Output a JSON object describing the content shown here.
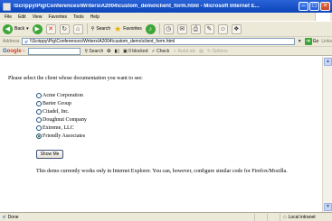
{
  "window": {
    "title": "\\Scrippy\\Pig\\Conferences\\Writers\\A2004\\custom_demo\\client_form.html - Microsoft Internet E..."
  },
  "menu": {
    "items": [
      "File",
      "Edit",
      "View",
      "Favorites",
      "Tools",
      "Help"
    ]
  },
  "toolbar": {
    "back_label": "Back",
    "search_label": "Search",
    "favorites_label": "Favorites"
  },
  "address": {
    "label": "Address",
    "value": "\\\\Scrippy\\Pig\\Conferences\\Writers\\A2004\\custom_demo\\client_form.html",
    "go_label": "Go",
    "links_label": "Links"
  },
  "googlebar": {
    "brand_g": "G",
    "brand_rest": "oogle -",
    "search_label": "Search",
    "blocked_label": "0 blocked",
    "check_label": "Check",
    "autolink_label": "AutoLink",
    "options_label": "Options"
  },
  "page": {
    "prompt": "Please select the client whose documentation you want to see:",
    "clients": [
      {
        "label": "Acme Corporation",
        "checked": false
      },
      {
        "label": "Barter Group",
        "checked": false
      },
      {
        "label": "Citadel, Inc.",
        "checked": false
      },
      {
        "label": "Doughnut Company",
        "checked": false
      },
      {
        "label": "Extreme, LLC",
        "checked": false
      },
      {
        "label": "Friendly Associates",
        "checked": true
      }
    ],
    "button_label": "Show Me",
    "note": "This demo currently works only in Internet Explorer. You can, however, configure similar code for Firefox/Mozilla."
  },
  "status": {
    "left": "Done",
    "zone": "Local intranet"
  },
  "colors": {
    "titlebar": "#0b44b8",
    "chrome": "#ece9d8",
    "go_green": "#3ea53b"
  }
}
